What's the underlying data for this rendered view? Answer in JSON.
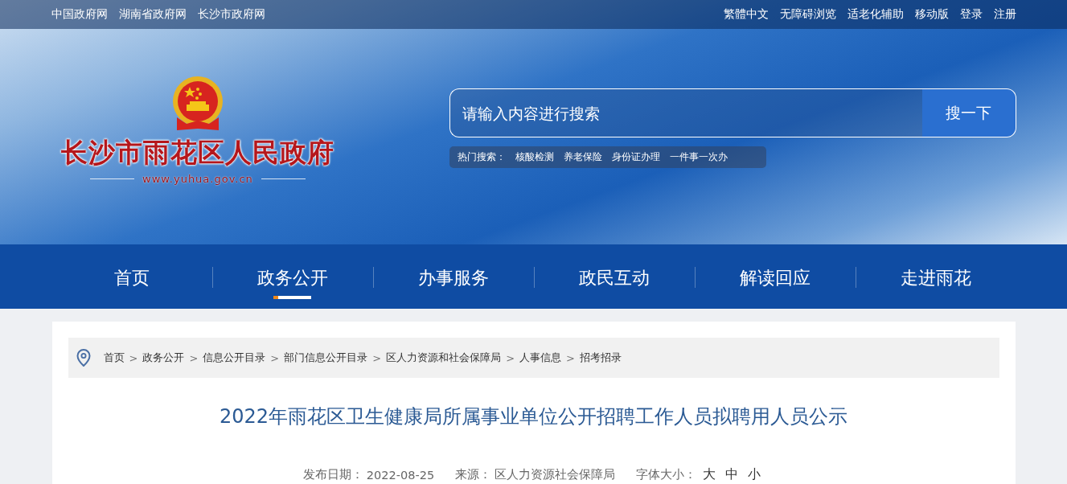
{
  "top_bar": {
    "left_links": [
      "中国政府网",
      "湖南省政府网",
      "长沙市政府网"
    ],
    "right_links": [
      "繁體中文",
      "无障碍浏览",
      "适老化辅助",
      "移动版",
      "登录",
      "注册"
    ]
  },
  "logo": {
    "title": "长沙市雨花区人民政府",
    "url": "www.yuhua.gov.cn"
  },
  "search": {
    "placeholder": "请输入内容进行搜索",
    "button": "搜一下",
    "hot_label": "热门搜索：",
    "hot_terms": [
      "核酸检测",
      "养老保险",
      "身份证办理",
      "一件事一次办"
    ]
  },
  "nav": [
    {
      "label": "首页",
      "selected": false
    },
    {
      "label": "政务公开",
      "selected": true
    },
    {
      "label": "办事服务",
      "selected": false
    },
    {
      "label": "政民互动",
      "selected": false
    },
    {
      "label": "解读回应",
      "selected": false
    },
    {
      "label": "走进雨花",
      "selected": false
    }
  ],
  "breadcrumb": [
    {
      "kind": "link",
      "text": "首页"
    },
    {
      "kind": "sep",
      "text": ">"
    },
    {
      "kind": "link",
      "text": "政务公开"
    },
    {
      "kind": "sep",
      "text": ">"
    },
    {
      "kind": "link",
      "text": "信息公开目录"
    },
    {
      "kind": "sep",
      "text": ">"
    },
    {
      "kind": "link",
      "text": "部门信息公开目录"
    },
    {
      "kind": "sep",
      "text": ">"
    },
    {
      "kind": "link",
      "text": "区人力资源和社会保障局"
    },
    {
      "kind": "sep",
      "text": ">"
    },
    {
      "kind": "link",
      "text": "人事信息"
    },
    {
      "kind": "sep",
      "text": ">"
    },
    {
      "kind": "link",
      "text": "招考招录"
    }
  ],
  "article": {
    "title": "2022年雨花区卫生健康局所属事业单位公开招聘工作人员拟聘用人员公示",
    "date_label": "发布日期：",
    "date": "2022-08-25",
    "source_label": "来源：",
    "source": "区人力资源社会保障局",
    "font_size_label": "字体大小：",
    "font_sizes": [
      "大",
      "中",
      "小"
    ]
  }
}
